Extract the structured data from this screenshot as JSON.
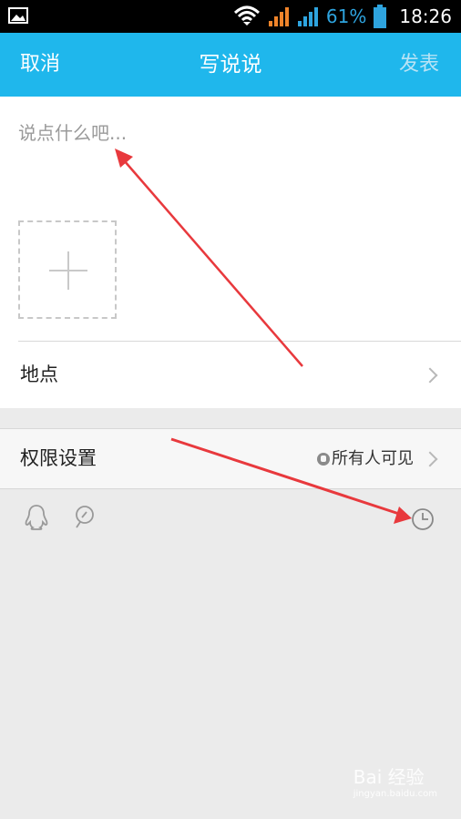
{
  "status_bar": {
    "battery": "61%",
    "time": "18:26",
    "icons": [
      "gallery-icon",
      "wifi-icon",
      "signal-icon",
      "signal-icon",
      "battery-icon"
    ]
  },
  "title_bar": {
    "cancel_label": "取消",
    "title": "写说说",
    "publish_label": "发表"
  },
  "compose": {
    "placeholder": "说点什么吧...",
    "add_photo_icon": "plus-icon"
  },
  "location": {
    "label": "地点",
    "icon": "chevron-right-icon"
  },
  "permission": {
    "label": "权限设置",
    "value": "所有人可见",
    "value_icon": "globe-icon",
    "chevron_icon": "chevron-right-icon"
  },
  "toolbar": {
    "icons": [
      "qq-penguin-icon",
      "at-mention-icon",
      "clock-icon"
    ]
  },
  "annotations": {
    "arrow_color": "#e8393d"
  },
  "watermark": {
    "text": "Bai 经验",
    "url": "jingyan.baidu.com"
  },
  "colors": {
    "title_bar_bg": "#1fb7ec",
    "page_bg": "#ebebeb"
  }
}
